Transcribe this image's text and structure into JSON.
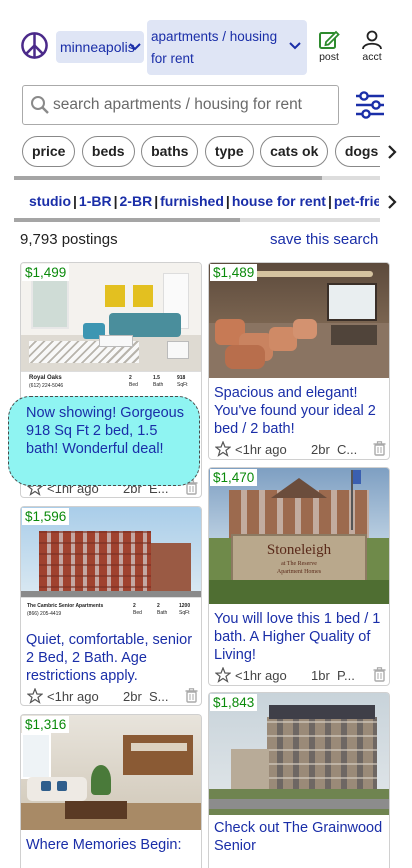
{
  "header": {
    "area": "minneapolis",
    "category": "apartments / housing for rent",
    "post_label": "post",
    "acct_label": "acct"
  },
  "search": {
    "placeholder": "search apartments / housing for rent"
  },
  "filters": [
    "price",
    "beds",
    "baths",
    "type",
    "cats ok",
    "dogs ok"
  ],
  "quick_links": [
    "studio",
    "1-BR",
    "2-BR",
    "furnished",
    "house for rent",
    "pet-friendly"
  ],
  "results": {
    "count": "9,793 postings",
    "save_search": "save this search"
  },
  "tooltip": "Now showing! Gorgeous 918 Sq Ft 2 bed, 1.5 bath! Wonderful deal!",
  "listings": [
    {
      "price": "$1,499",
      "title": "Now showing! Gorgeous 918 Sq Ft 2 bed, 1.5 bath! Wonderful deal!",
      "age": "<1hr ago",
      "beds": "2br",
      "location": "E...",
      "image_caption": "Royal Oaks",
      "image_phone": "(612) 224-5046",
      "image_stats": [
        "2",
        "1.5",
        "918"
      ],
      "image_stat_labels": [
        "Bed",
        "Bath",
        "SqFt"
      ]
    },
    {
      "price": "$1,489",
      "title": "Spacious and elegant! You've found your ideal 2 bed / 2 bath!",
      "age": "<1hr ago",
      "beds": "2br",
      "location": "C..."
    },
    {
      "price": "$1,596",
      "title": "Quiet, comfortable, senior 2 Bed, 2 Bath. Age restrictions apply.",
      "age": "<1hr ago",
      "beds": "2br",
      "location": "S...",
      "image_caption": "The Cambric Senior Apartments",
      "image_phone": "(866) 205-4419",
      "image_stats": [
        "2",
        "2",
        "1200"
      ],
      "image_stat_labels": [
        "Bed",
        "Bath",
        "SqFt"
      ]
    },
    {
      "price": "$1,470",
      "title": "You will love this 1 bed / 1 bath. A Higher Quality of Living!",
      "age": "<1hr ago",
      "beds": "1br",
      "location": "P...",
      "sign_name": "Stoneleigh",
      "sign_sub": "at The Reserve",
      "sign_sub2": "Apartment Homes"
    },
    {
      "price": "$1,316",
      "title": "Where Memories Begin:"
    },
    {
      "price": "$1,843",
      "title": "Check out The Grainwood Senior"
    }
  ],
  "colors": {
    "link_blue": "#1a2ea8",
    "price_green": "#0a8a0a",
    "select_bg": "#dfe5f5",
    "tooltip_bg": "#8ff4f2",
    "peace_purple": "#4b2a8a",
    "post_green": "#2e8b2e"
  },
  "icons": [
    "peace-sign-icon",
    "chevron-down-icon",
    "post-edit-icon",
    "account-icon",
    "search-icon",
    "filter-sliders-icon",
    "chevron-right-icon",
    "star-icon",
    "trash-icon"
  ]
}
